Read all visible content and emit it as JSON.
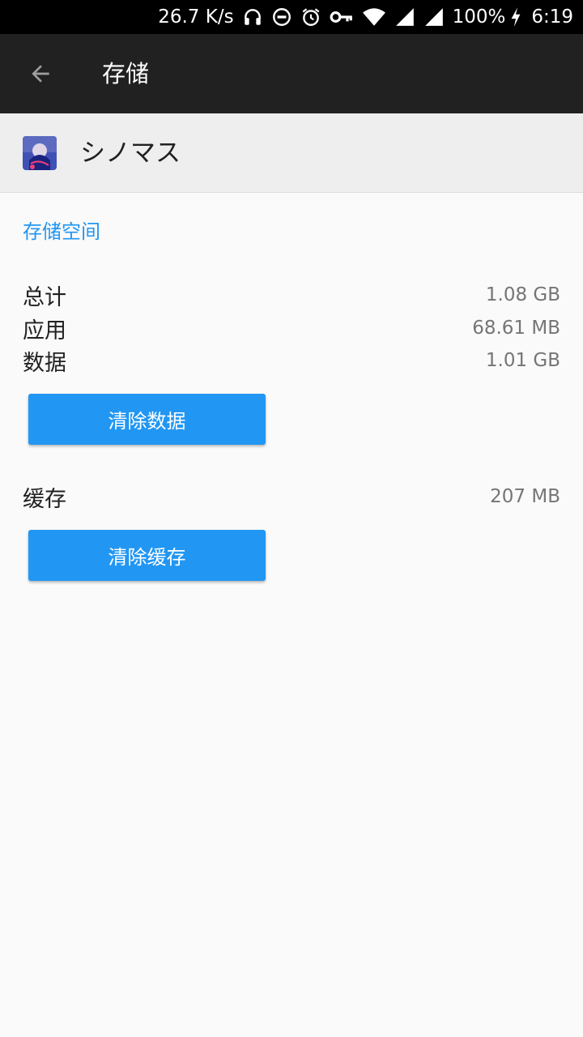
{
  "status_bar": {
    "network_speed": "26.7 K/s",
    "battery": "100%",
    "time": "6:19",
    "icons": [
      "headphones-icon",
      "dnd-icon",
      "alarm-icon",
      "vpn-key-icon",
      "wifi-icon",
      "signal-icon",
      "signal-icon-2",
      "charging-icon"
    ]
  },
  "toolbar": {
    "back_icon": "arrow-back-icon",
    "title": "存储"
  },
  "app": {
    "name": "シノマス",
    "icon": "app-icon"
  },
  "storage": {
    "section_title": "存储空间",
    "rows": [
      {
        "label": "总计",
        "value": "1.08 GB"
      },
      {
        "label": "应用",
        "value": "68.61 MB"
      },
      {
        "label": "数据",
        "value": "1.01 GB"
      }
    ],
    "clear_data_label": "清除数据"
  },
  "cache": {
    "label": "缓存",
    "value": "207 MB",
    "clear_cache_label": "清除缓存"
  },
  "colors": {
    "accent": "#2196f3",
    "toolbar": "#212121",
    "status_bar": "#000000",
    "background": "#fafafa"
  }
}
